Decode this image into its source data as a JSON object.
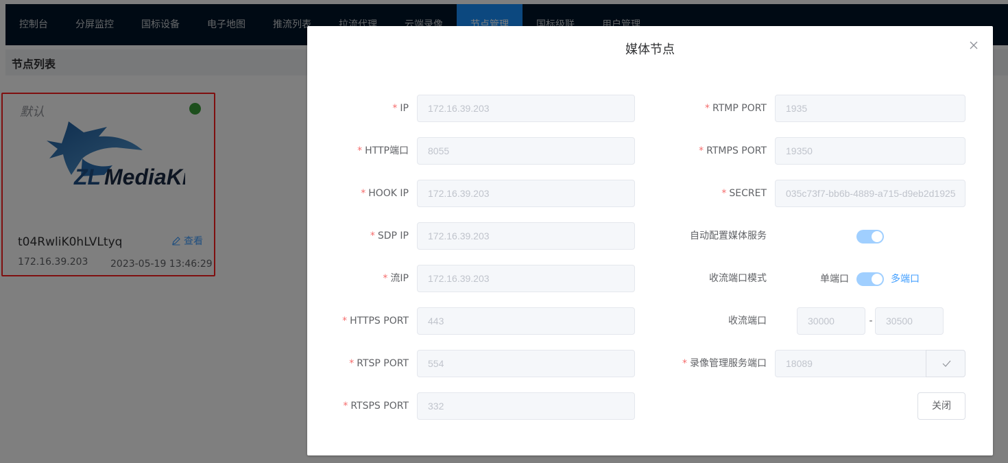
{
  "nav": {
    "items": [
      "控制台",
      "分屏监控",
      "国标设备",
      "电子地图",
      "推流列表",
      "拉流代理",
      "云端录像",
      "节点管理",
      "国标级联",
      "用户管理"
    ],
    "active_index": 7
  },
  "subbar": {
    "title": "节点列表"
  },
  "node_card": {
    "tag": "默认",
    "status_color": "#3a9e3a",
    "logo_text": "ZLMediaKit",
    "name": "t04RwliK0hLVLtyq",
    "view_label": "查看",
    "ip": "172.16.39.203",
    "time": "2023-05-19 13:46:29"
  },
  "dialog": {
    "title": "媒体节点",
    "left_fields": [
      {
        "label": "IP",
        "value": "172.16.39.203"
      },
      {
        "label": "HTTP端口",
        "value": "8055"
      },
      {
        "label": "HOOK IP",
        "value": "172.16.39.203"
      },
      {
        "label": "SDP IP",
        "value": "172.16.39.203"
      },
      {
        "label": "流IP",
        "value": "172.16.39.203"
      },
      {
        "label": "HTTPS PORT",
        "value": "443"
      },
      {
        "label": "RTSP PORT",
        "value": "554"
      },
      {
        "label": "RTSPS PORT",
        "value": "332"
      }
    ],
    "right_fields": {
      "rtmp_port": {
        "label": "RTMP PORT",
        "value": "1935"
      },
      "rtmps_port": {
        "label": "RTMPS PORT",
        "value": "19350"
      },
      "secret": {
        "label": "SECRET",
        "value": "035c73f7-bb6b-4889-a715-d9eb2d1925"
      },
      "auto_config": {
        "label": "自动配置媒体服务",
        "on": true
      },
      "port_mode": {
        "label": "收流端口模式",
        "left_text": "单端口",
        "right_text": "多端口",
        "on": true
      },
      "recv_ports": {
        "label": "收流端口",
        "from": "30000",
        "separator": "-",
        "to": "30500"
      },
      "record_port": {
        "label": "录像管理服务端口",
        "value": "18089"
      }
    },
    "close_label": "关闭"
  },
  "colors": {
    "topbar": "#001529",
    "active_nav": "#1890ff",
    "required": "#f56c6c",
    "switch_on": "#a0cfff",
    "link": "#409eff"
  }
}
